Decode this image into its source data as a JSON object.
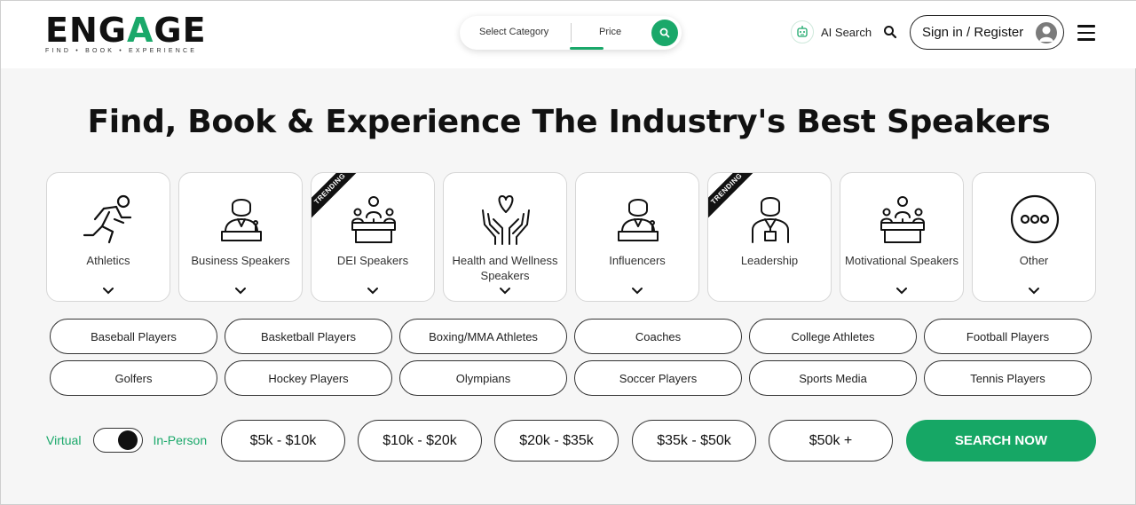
{
  "header": {
    "logo_text_pre": "ENG",
    "logo_text_a": "A",
    "logo_text_post": "GE",
    "logo_tagline": "FIND • BOOK • EXPERIENCE",
    "select_category": "Select Category",
    "price": "Price",
    "ai_search": "AI Search",
    "sign_in": "Sign in / Register"
  },
  "hero": {
    "title": "Find, Book & Experience The Industry's Best Speakers"
  },
  "categories": [
    {
      "label": "Athletics",
      "icon": "runner-icon",
      "trending": false
    },
    {
      "label": "Business Speakers",
      "icon": "business-speaker-icon",
      "trending": false
    },
    {
      "label": "DEI Speakers",
      "icon": "podium-speakers-icon",
      "trending": true
    },
    {
      "label": "Health and Wellness Speakers",
      "icon": "hands-heart-icon",
      "trending": false
    },
    {
      "label": "Influencers",
      "icon": "influencer-icon",
      "trending": false
    },
    {
      "label": "Leadership",
      "icon": "leader-icon",
      "trending": true
    },
    {
      "label": "Motivational Speakers",
      "icon": "podium-speakers-icon",
      "trending": false
    },
    {
      "label": "Other",
      "icon": "more-circle-icon",
      "trending": false
    }
  ],
  "trending_label": "TRENDING",
  "subcategories": [
    "Baseball Players",
    "Basketball Players",
    "Boxing/MMA Athletes",
    "Coaches",
    "College Athletes",
    "Football Players",
    "Golfers",
    "Hockey Players",
    "Olympians",
    "Soccer Players",
    "Sports Media",
    "Tennis Players"
  ],
  "toggle": {
    "left": "Virtual",
    "right": "In-Person"
  },
  "price_ranges": [
    "$5k - $10k",
    "$10k - $20k",
    "$20k - $35k",
    "$35k - $50k",
    "$50k +"
  ],
  "search_button": "SEARCH NOW",
  "colors": {
    "accent": "#16a765",
    "text": "#111111",
    "bg": "#f6f6f6"
  }
}
